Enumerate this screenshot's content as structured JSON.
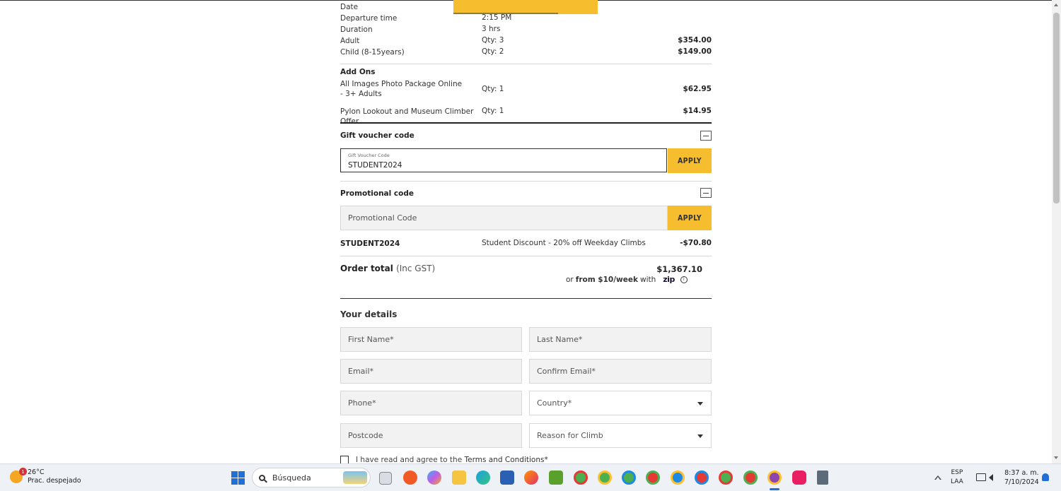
{
  "booking": {
    "tooltip_text": "",
    "rows": [
      {
        "label": "Date",
        "qty": "",
        "price": ""
      },
      {
        "label": "Departure time",
        "qty": "2:15 PM",
        "price": ""
      },
      {
        "label": "Duration",
        "qty": "3 hrs",
        "price": ""
      },
      {
        "label": "Adult",
        "qty": "Qty: 3",
        "price": "$354.00"
      },
      {
        "label": "Child (8-15years)",
        "qty": "Qty: 2",
        "price": "$149.00"
      }
    ]
  },
  "addons": {
    "title": "Add Ons",
    "items": [
      {
        "label": "All Images Photo Package Online - 3+ Adults",
        "qty": "Qty: 1",
        "price": "$62.95"
      },
      {
        "label": "Pylon Lookout and Museum Climber Offer",
        "qty": "Qty: 1",
        "price": "$14.95"
      }
    ]
  },
  "gift_voucher": {
    "title": "Gift voucher code",
    "field_label": "Gift Voucher Code",
    "value": "STUDENT2024",
    "apply_label": "APPLY"
  },
  "promo": {
    "title": "Promotional code",
    "placeholder": "Promotional Code",
    "apply_label": "APPLY",
    "applied_code": "STUDENT2024",
    "applied_desc": "Student Discount - 20% off Weekday Climbs",
    "applied_amount": "-$70.80"
  },
  "order_total": {
    "label": "Order total",
    "suffix": "(Inc GST)",
    "value": "$1,367.10",
    "zip_prefix": "or",
    "zip_amount": "from $10/week",
    "zip_with": "with",
    "zip_logo": "zip"
  },
  "details": {
    "title": "Your details",
    "first_name": "First Name*",
    "last_name": "Last Name*",
    "email": "Email*",
    "confirm_email": "Confirm Email*",
    "phone": "Phone*",
    "country": "Country*",
    "postcode": "Postcode",
    "reason": "Reason for Climb",
    "terms_prefix": "I have read and agree to the",
    "terms_link": "Terms and Conditions*"
  },
  "taskbar": {
    "weather_temp": "26°C",
    "weather_desc": "Prac. despejado",
    "weather_badge": "1",
    "search_placeholder": "Búsqueda",
    "lang_top": "ESP",
    "lang_bottom": "LAA",
    "time": "8:37 a. m.",
    "date": "7/10/2024",
    "accent": "#1f6fd6"
  },
  "colors": {
    "apply_button": "#f6bd2e"
  }
}
